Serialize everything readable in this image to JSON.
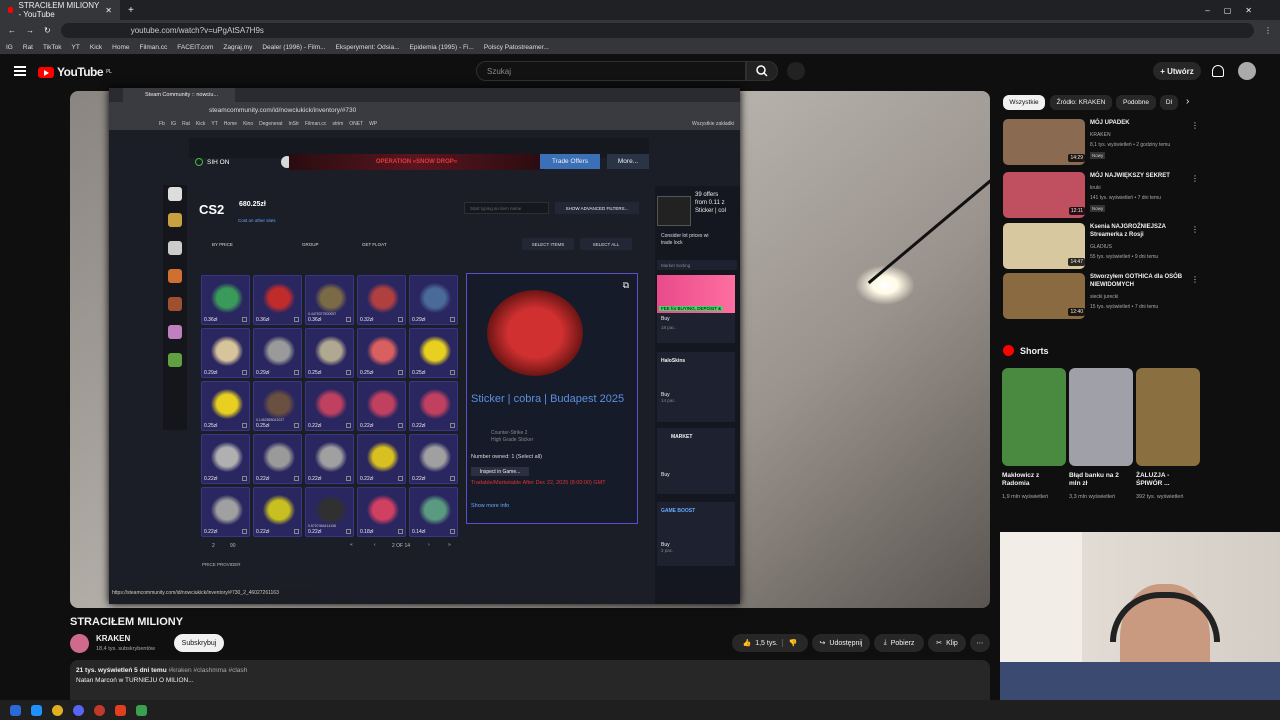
{
  "chrome": {
    "tab_title": "STRACIŁEM MILIONY - YouTube",
    "url": "youtube.com/watch?v=uPgAtSA7H9s",
    "bookmarks": [
      "IG",
      "Rat",
      "TikTok",
      "YT",
      "Kick",
      "Home",
      "Filman.cc",
      "FACEIT.com",
      "Zagraj.my",
      "Dealer (1996) - Film...",
      "Eksperyment: Odsia...",
      "Epidemia (1995) - Fi...",
      "Polscy Patostreamer..."
    ]
  },
  "yt": {
    "logo": "YouTube",
    "logo_region": "PL",
    "search_placeholder": "Szukaj",
    "create_label": "+ Utwórz"
  },
  "inner_browser": {
    "tab_title": "Steam Community :: nowciu...",
    "url": "steamcommunity.com/id/nowciukick/inventory/#730",
    "bookmarks": [
      "Fb",
      "IG",
      "Rat",
      "Kick",
      "YT",
      "Home",
      "Kino",
      "Degenerat",
      "InStr",
      "Filman.cc",
      "strim",
      "ONET",
      "WP"
    ],
    "bookmarks_right": "Wszystkie zakładki",
    "status_url": "https://steamcommunity.com/id/nowciukick/inventory/#730_2_46027261163"
  },
  "steam": {
    "sih": "SIH ON",
    "operation": "OPERATION «SNOW DROP»",
    "trade_offers": "Trade Offers",
    "more": "More...",
    "game": "CS2",
    "wallet": "680.25zł",
    "cost_other": "Cost on other sites",
    "search_placeholder": "Start typing an item name",
    "adv_filters": "SHOW ADVANCED FILTERS...",
    "by_price": "BY PRICE",
    "group": "GROUP",
    "get_float": "GET FLOAT",
    "select_items": "SELECT ITEMS",
    "select_all": "SELECT ALL",
    "pager": {
      "page_size": "2",
      "per_page": "90",
      "page_info": "2 OF 14"
    },
    "price_provider": "PRICE PROVIDER",
    "detail": {
      "title": "Sticker | cobra | Budapest 2025",
      "game": "Counter-Strike 2",
      "grade": "High Grade Sticker",
      "owned": "Number owned: 1 (Select all)",
      "inspect": "Inspect in Game...",
      "tradable": "Tradable/Marketable After Dec 22, 2025 (8:00:00) GMT",
      "show_more": "Show more info"
    },
    "offers": [
      "39 offers",
      "from 0.11 z",
      "Sticker | col"
    ],
    "consider": [
      "Consider lot prices wi",
      "trade lock"
    ],
    "market_sorting": "Market Sorting",
    "providers": [
      {
        "name": "FEE for BUYING, DEPOSIT &",
        "buy": "Buy",
        "qty": "18 pac."
      },
      {
        "name": "HaloSkins",
        "buy": "Buy",
        "qty": "14 pac."
      },
      {
        "name": "MARKET",
        "buy": "Buy",
        "qty": ""
      },
      {
        "name": "GAME BOOST",
        "buy": "Buy",
        "qty": "2 pac."
      }
    ],
    "items": [
      {
        "price": "0.36zł",
        "color": "#3a9a5a"
      },
      {
        "price": "0.36zł",
        "color": "#c02b2b"
      },
      {
        "price": "0.36zł",
        "color": "#7a6a45",
        "float": "0.4475377500057"
      },
      {
        "price": "0.32zł",
        "color": "#b04040"
      },
      {
        "price": "0.29zł",
        "color": "#4a6a9a"
      },
      {
        "price": "0.29zł",
        "color": "#d8c49a"
      },
      {
        "price": "0.29zł",
        "color": "#9a9a9a"
      },
      {
        "price": "0.25zł",
        "color": "#b0a890"
      },
      {
        "price": "0.25zł",
        "color": "#d86060"
      },
      {
        "price": "0.25zł",
        "color": "#e8d020"
      },
      {
        "price": "0.25zł",
        "color": "#e8d020"
      },
      {
        "price": "0.25zł",
        "color": "#6a5040",
        "float": "0.1462855041027"
      },
      {
        "price": "0.22zł",
        "color": "#c04060"
      },
      {
        "price": "0.22zł",
        "color": "#c04060"
      },
      {
        "price": "0.22zł",
        "color": "#c04060"
      },
      {
        "price": "0.22zł",
        "color": "#b0b0b0"
      },
      {
        "price": "0.22zł",
        "color": "#9a9a9a"
      },
      {
        "price": "0.22zł",
        "color": "#a0a0a0"
      },
      {
        "price": "0.22zł",
        "color": "#d8c020"
      },
      {
        "price": "0.22zł",
        "color": "#a0a0a0"
      },
      {
        "price": "0.22zł",
        "color": "#a0a0a0"
      },
      {
        "price": "0.22zł",
        "color": "#c8c020"
      },
      {
        "price": "0.22zł",
        "color": "#303030",
        "float": "0.5707464414156"
      },
      {
        "price": "0.18zł",
        "color": "#d04060"
      },
      {
        "price": "0.14zł",
        "color": "#5a9a80"
      }
    ]
  },
  "video": {
    "title": "STRACIŁEM MILIONY",
    "channel": "KRAKEN",
    "subs": "18,4 tys. subskrybentów",
    "subscribe": "Subskrybuj",
    "likes": "1,5 tys.",
    "share": "Udostępnij",
    "download": "Pobierz",
    "clip": "Klip",
    "views": "21 tys. wyświetleń  5 dni temu",
    "tags": "#kraken #clashmma #clash",
    "desc_line": "Natan Marcoń w TURNIEJU O MILION..."
  },
  "chips": [
    "Wszystkie",
    "Źródło: KRAKEN",
    "Podobne",
    "Dl"
  ],
  "recs": [
    {
      "title": "MÓJ UPADEK",
      "channel": "KRAKEN",
      "meta": "8,1 tys. wyświetleń • 2 godziny temu",
      "badge": "Nowy",
      "time": "14:29",
      "color": "#8a6a50"
    },
    {
      "title": "MÓJ NAJWIĘKSZY SEKRET",
      "channel": "kruki",
      "meta": "141 tys. wyświetleń • 7 dni temu",
      "badge": "Nowy",
      "time": "12:11",
      "color": "#c05060"
    },
    {
      "title": "Ksenia NAJGROŹNIEJSZA Streamerka z Rosji",
      "channel": "GLADIUS",
      "meta": "55 tys. wyświetleń • 9 dni temu",
      "badge": "",
      "time": "14:47",
      "color": "#d8c8a0"
    },
    {
      "title": "Stworzyłem GOTHICA dla OSÓB NIEWIDOMYCH",
      "channel": "siecki jurecki",
      "meta": "15 tys. wyświetleń • 7 dni temu",
      "badge": "",
      "time": "12:40",
      "color": "#8a6a40"
    }
  ],
  "shorts_label": "Shorts",
  "shorts": [
    {
      "title": "Makłowicz z Radomia",
      "views": "1,9 mln wyświetleń",
      "color": "#4a8a40"
    },
    {
      "title": "Błąd banku na 2 mln zł",
      "views": "3,3 mln wyświetleń",
      "color": "#a0a0a8"
    },
    {
      "title": "ŻALUZJA - ŚPIWÓR ...",
      "views": "392 tys. wyświetleń",
      "color": "#8a7040"
    }
  ]
}
